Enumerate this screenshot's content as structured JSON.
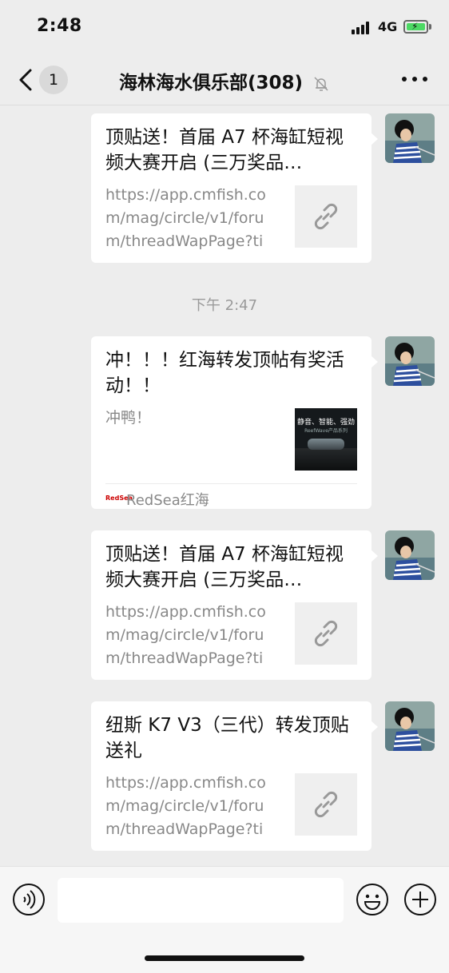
{
  "status_bar": {
    "time": "2:48",
    "network": "4G"
  },
  "nav": {
    "unread_count": "1",
    "title": "海林海水俱乐部(308)"
  },
  "messages": [
    {
      "title": "顶贴送！首届 A7 杯海缸短视频大赛开启 (三万奖品…",
      "desc": "https://app.cmfish.com/mag/circle/v1/forum/threadWapPage?tid…"
    },
    {
      "title": "冲！！！红海转发顶帖有奖活动！！",
      "desc": "冲鸭！",
      "thumb_text": "静音、智能、强劲",
      "thumb_subtext": "ReefWave产品系列",
      "source_logo": "RedSea",
      "source": "RedSea红海"
    },
    {
      "title": "顶贴送！首届 A7 杯海缸短视频大赛开启 (三万奖品…",
      "desc": "https://app.cmfish.com/mag/circle/v1/forum/threadWapPage?tid…"
    },
    {
      "title": "纽斯 K7 V3（三代）转发顶贴送礼",
      "desc": "https://app.cmfish.com/mag/circle/v1/forum/threadWapPage?tid…"
    }
  ],
  "time_separator": "下午 2:47",
  "input": {
    "placeholder": ""
  },
  "colors": {
    "background": "#ededed",
    "bubble": "#ffffff",
    "battery": "#4cd964"
  }
}
